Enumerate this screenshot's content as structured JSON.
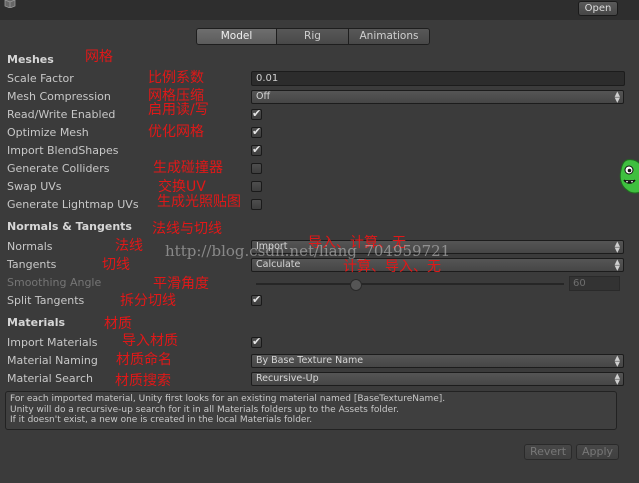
{
  "header": {
    "open_label": "Open"
  },
  "tabs": [
    {
      "label": "Model",
      "active": true
    },
    {
      "label": "Rig",
      "active": false
    },
    {
      "label": "Animations",
      "active": false
    }
  ],
  "meshes": {
    "title": "Meshes",
    "title_note": "网格",
    "scale_factor": {
      "label": "Scale Factor",
      "value": "0.01",
      "note": "比例系数"
    },
    "mesh_compression": {
      "label": "Mesh Compression",
      "value": "Off",
      "note": "网格压缩"
    },
    "read_write": {
      "label": "Read/Write Enabled",
      "checked": true,
      "note": "启用读/写"
    },
    "optimize_mesh": {
      "label": "Optimize Mesh",
      "checked": true,
      "note": "优化网格"
    },
    "import_blendshapes": {
      "label": "Import BlendShapes",
      "checked": true
    },
    "generate_colliders": {
      "label": "Generate Colliders",
      "checked": false,
      "note": "生成碰撞器"
    },
    "swap_uvs": {
      "label": "Swap UVs",
      "checked": false,
      "note": "交换UV"
    },
    "lightmap_uvs": {
      "label": "Generate Lightmap UVs",
      "checked": false,
      "note": "生成光照贴图"
    }
  },
  "normals": {
    "title": "Normals & Tangents",
    "title_note": "法线与切线",
    "normals": {
      "label": "Normals",
      "value": "Import",
      "note": "法线",
      "options_note": "导入、计算、无"
    },
    "tangents": {
      "label": "Tangents",
      "value": "Calculate",
      "note": "切线",
      "options_note": "计算、导入、无"
    },
    "smoothing_angle": {
      "label": "Smoothing Angle",
      "value": "60",
      "note": "平滑角度"
    },
    "split_tangents": {
      "label": "Split Tangents",
      "checked": true,
      "note": "拆分切线"
    }
  },
  "materials": {
    "title": "Materials",
    "title_note": "材质",
    "import_materials": {
      "label": "Import Materials",
      "checked": true,
      "note": "导入材质"
    },
    "material_naming": {
      "label": "Material Naming",
      "value": "By Base Texture Name",
      "note": "材质命名"
    },
    "material_search": {
      "label": "Material Search",
      "value": "Recursive-Up",
      "note": "材质搜索"
    }
  },
  "help": {
    "line1": "For each imported material, Unity first looks for an existing material named [BaseTextureName].",
    "line2": "Unity will do a recursive-up search for it in all Materials folders up to the Assets folder.",
    "line3": "If it doesn't exist, a new one is created in the local Materials folder."
  },
  "footer": {
    "revert_label": "Revert",
    "apply_label": "Apply"
  },
  "watermark": "http://blog.csdn.net/liang_704959721",
  "colors": {
    "annotation": "#e01818",
    "panel": "#3b3b3b"
  }
}
